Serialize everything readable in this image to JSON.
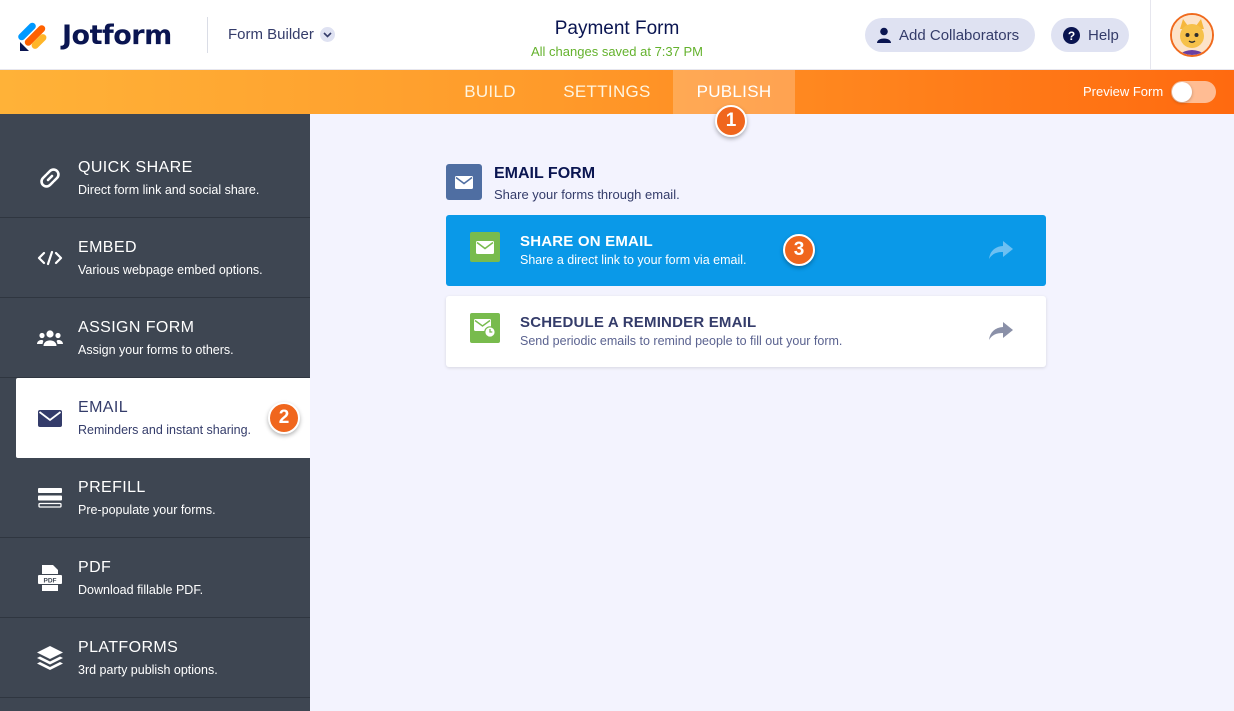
{
  "header": {
    "logo_text": "Jotform",
    "builder_label": "Form Builder",
    "form_title": "Payment Form",
    "save_status": "All changes saved at 7:37 PM",
    "collaborators_label": "Add Collaborators",
    "help_label": "Help"
  },
  "nav": {
    "tabs": [
      {
        "label": "BUILD"
      },
      {
        "label": "SETTINGS"
      },
      {
        "label": "PUBLISH",
        "active": true
      }
    ],
    "preview_label": "Preview Form",
    "preview_on": false
  },
  "badges": [
    "1",
    "2",
    "3"
  ],
  "sidebar": {
    "items": [
      {
        "title": "QUICK SHARE",
        "subtitle": "Direct form link and social share.",
        "icon": "link-icon"
      },
      {
        "title": "EMBED",
        "subtitle": "Various webpage embed options.",
        "icon": "code-icon"
      },
      {
        "title": "ASSIGN FORM",
        "subtitle": "Assign your forms to others.",
        "icon": "users-icon"
      },
      {
        "title": "EMAIL",
        "subtitle": "Reminders and instant sharing.",
        "icon": "envelope-icon",
        "active": true
      },
      {
        "title": "PREFILL",
        "subtitle": "Pre-populate your forms.",
        "icon": "prefill-icon"
      },
      {
        "title": "PDF",
        "subtitle": "Download fillable PDF.",
        "icon": "pdf-icon"
      },
      {
        "title": "PLATFORMS",
        "subtitle": "3rd party publish options.",
        "icon": "layers-icon"
      }
    ]
  },
  "main": {
    "section_title": "EMAIL FORM",
    "section_subtitle": "Share your forms through email.",
    "cards": [
      {
        "title": "SHARE ON EMAIL",
        "subtitle": "Share a direct link to your form via email.",
        "icon": "envelope-icon",
        "highlighted": true
      },
      {
        "title": "SCHEDULE A REMINDER EMAIL",
        "subtitle": "Send periodic emails to remind people to fill out your form.",
        "icon": "envelope-clock-icon"
      }
    ]
  },
  "colors": {
    "brand_navy": "#0a1551",
    "nav_orange": "#ff7b18",
    "sidebar_bg": "#3e4652",
    "accent_blue": "#0a99e8",
    "badge_orange": "#f0661d",
    "saved_green": "#64b22d"
  }
}
